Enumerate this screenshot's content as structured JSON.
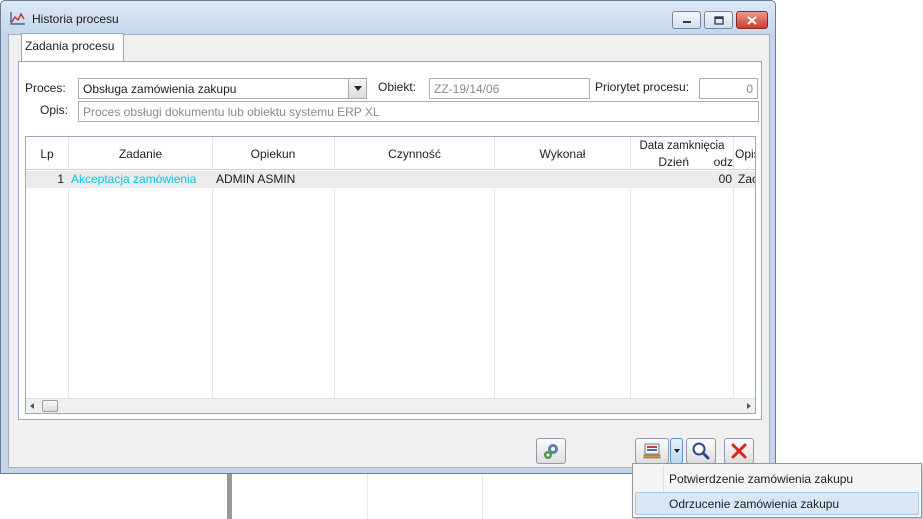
{
  "window": {
    "title": "Historia procesu"
  },
  "tabs": [
    {
      "label": "Zadania procesu"
    }
  ],
  "form": {
    "proces_label": "Proces:",
    "proces_value": "Obsługa zamówienia zakupu",
    "obiekt_label": "Obiekt:",
    "obiekt_value": "ZZ-19/14/06",
    "priorytet_label": "Priorytet procesu:",
    "priorytet_value": "0",
    "opis_label": "Opis:",
    "opis_value": "Proces obsługi dokumentu lub obiektu systemu ERP XL"
  },
  "table": {
    "columns": {
      "lp": "Lp",
      "zadanie": "Zadanie",
      "opiekun": "Opiekun",
      "czynnosc": "Czynność",
      "wykonal": "Wykonał",
      "data_zamkniecia": "Data zamknięcia",
      "dzien": "Dzień",
      "godz": "odz",
      "opis": "Opis"
    },
    "rows": [
      {
        "lp": "1",
        "zadanie": "Akceptacja zamówienia",
        "opiekun": "ADMIN ASMIN",
        "czynnosc": "",
        "wykonal": "",
        "dzien": "",
        "godz": "00",
        "opis": "Zac"
      }
    ]
  },
  "toolbar": {
    "icons": [
      "gears-icon",
      "document-action-icon",
      "magnifier-icon",
      "delete-x-icon"
    ]
  },
  "popup_menu": {
    "items": [
      {
        "label": "Potwierdzenie zamówienia zakupu"
      },
      {
        "label": "Odrzucenie zamówienia zakupu"
      }
    ]
  },
  "colors": {
    "task_link": "#00c8e6",
    "close_button": "#c8402c",
    "delete_icon": "#d42a1e"
  }
}
